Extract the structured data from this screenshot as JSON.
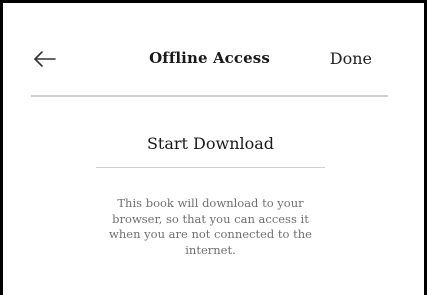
{
  "header": {
    "back_icon": "arrow-left-icon",
    "title": "Offline Access",
    "done_label": "Done"
  },
  "main": {
    "download_label": "Start Download",
    "description": "This book will download to your browser, so that you can access it when you are not connected to the internet."
  },
  "colors": {
    "text": "#1a1a1a",
    "muted_text": "#6f6f6f",
    "divider": "#d0d0d0",
    "frame_border": "#000000"
  }
}
